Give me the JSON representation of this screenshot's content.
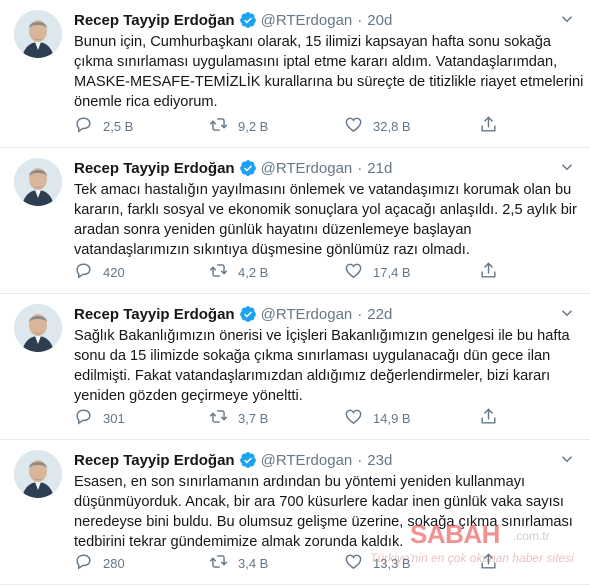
{
  "author": {
    "name": "Recep Tayyip Erdoğan",
    "handle": "@RTErdogan",
    "separator": "·"
  },
  "tweets": [
    {
      "time": "20d",
      "lines": [
        "Bunun için, Cumhurbaşkanı olarak, 15 ilimizi kapsayan hafta sonu sokağa",
        "çıkma sınırlaması uygulamasını iptal etme kararı aldım. Vatandaşlarımdan,",
        "MASKE-MESAFE-TEMİZLİK kurallarına bu süreçte de titizlikle riayet etmelerini",
        "önemle rica ediyorum."
      ],
      "replies": "2,5 B",
      "retweets": "9,2 B",
      "likes": "32,8 B"
    },
    {
      "time": "21d",
      "lines": [
        "Tek amacı hastalığın yayılmasını önlemek ve vatandaşımızı korumak olan bu",
        "kararın, farklı sosyal ve ekonomik sonuçlara yol açacağı anlaşıldı. 2,5 aylık bir",
        "aradan sonra yeniden günlük hayatını düzenlemeye başlayan",
        "vatandaşlarımızın sıkıntıya düşmesine gönlümüz razı olmadı."
      ],
      "replies": "420",
      "retweets": "4,2 B",
      "likes": "17,4 B"
    },
    {
      "time": "22d",
      "lines": [
        "Sağlık Bakanlığımızın önerisi ve İçişleri Bakanlığımızın genelgesi ile bu hafta",
        "sonu da 15 ilimizde sokağa çıkma sınırlaması uygulanacağı dün gece ilan",
        "edilmişti. Fakat vatandaşlarımızdan aldığımız değerlendirmeler, bizi kararı",
        "yeniden gözden geçirmeye yöneltti."
      ],
      "replies": "301",
      "retweets": "3,7 B",
      "likes": "14,9 B"
    },
    {
      "time": "23d",
      "lines": [
        "Esasen, en son sınırlamanın ardından bu yöntemi yeniden kullanmayı",
        "düşünmüyorduk. Ancak, bir ara 700 küsurlere kadar inen günlük vaka sayısı",
        "neredeyse bini buldu. Bu olumsuz gelişme üzerine, sokağa çıkma sınırlaması",
        "tedbirini tekrar gündemimize almak zorunda kaldık."
      ],
      "replies": "280",
      "retweets": "3,4 B",
      "likes": "13,3 B"
    }
  ],
  "watermark": {
    "logo": "SABAH",
    "tld": ".com.tr",
    "tagline": "Türkiye'nin en çok okunan haber sitesi"
  },
  "icons": {
    "verified": "verified-badge-icon",
    "reply": "reply-icon",
    "retweet": "retweet-icon",
    "like": "heart-icon",
    "share": "share-icon",
    "more": "chevron-down-icon"
  },
  "colors": {
    "text": "#14171a",
    "muted": "#657786",
    "verified": "#1da1f2",
    "divider": "#e6ecf0",
    "watermark": "#e53935"
  }
}
